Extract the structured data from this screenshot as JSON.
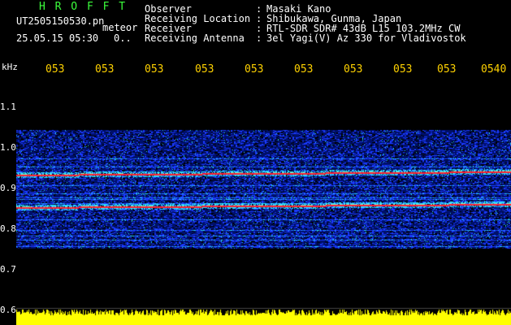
{
  "header": {
    "brand": "H R O F F T",
    "filename": "UT2505150530.pn",
    "mode": "meteor",
    "datetime": "25.05.15 05:30",
    "extra": "0..",
    "rows": [
      {
        "label": "Observer",
        "value": "Masaki Kano"
      },
      {
        "label": "Receiving Location",
        "value": "Shibukawa, Gunma, Japan"
      },
      {
        "label": "Receiver",
        "value": "RTL-SDR SDR# 43dB L15 103.2MHz CW"
      },
      {
        "label": "Receiving Antenna",
        "value": "3el Yagi(V) Az 330 for Vladivostok"
      }
    ],
    "separator": ":"
  },
  "axis": {
    "unit": "kHz",
    "time_ticks": [
      "053",
      "053",
      "053",
      "053",
      "053",
      "053",
      "053",
      "053",
      "053",
      "0540"
    ],
    "freq_ticks": [
      "1.1",
      "1.0",
      "0.9",
      "0.8",
      "0.7",
      "0.6"
    ]
  },
  "spectrogram": {
    "f_max": 1.1,
    "f_min": 0.6,
    "signal_lines_khz": [
      0.93,
      0.85
    ],
    "band_lines_khz": [
      0.97,
      0.95,
      0.905,
      0.885,
      0.875,
      0.87,
      0.86,
      0.82,
      0.795,
      0.78,
      0.77,
      0.755
    ],
    "noise_band_khz": [
      0.75,
      1.04
    ],
    "colors": {
      "background": "#000000",
      "noise_dark": "#00106a",
      "noise_mid": "#1a3aff",
      "noise_bright": "#2ad8ff",
      "signal": "#ff2030",
      "noise_floor": "#ffff00",
      "brand": "#3cff3c",
      "tick": "#ffd200"
    }
  }
}
